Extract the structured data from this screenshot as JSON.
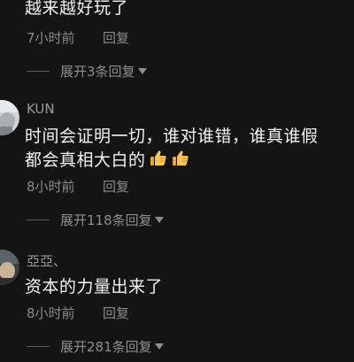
{
  "comments": [
    {
      "text_lines": [
        "越来越好玩了"
      ],
      "time": "7小时前",
      "reply_label": "回复",
      "expand_label": "展开3条回复"
    },
    {
      "username": "KUN",
      "text_lines": [
        "时间会证明一切，谁对谁错，谁真谁假",
        "都会真相大白的"
      ],
      "emojis": [
        "thumbs-up-icon",
        "thumbs-up-icon"
      ],
      "time": "8小时前",
      "reply_label": "回复",
      "expand_label": "展开118条回复"
    },
    {
      "username": "亞亞、",
      "text_lines": [
        "资本的力量出来了"
      ],
      "time": "8小时前",
      "reply_label": "回复",
      "expand_label": "展开281条回复"
    }
  ],
  "colors": {
    "background": "#141414",
    "primary_text": "#f2f2f2",
    "secondary_text": "#8a8a8a"
  }
}
